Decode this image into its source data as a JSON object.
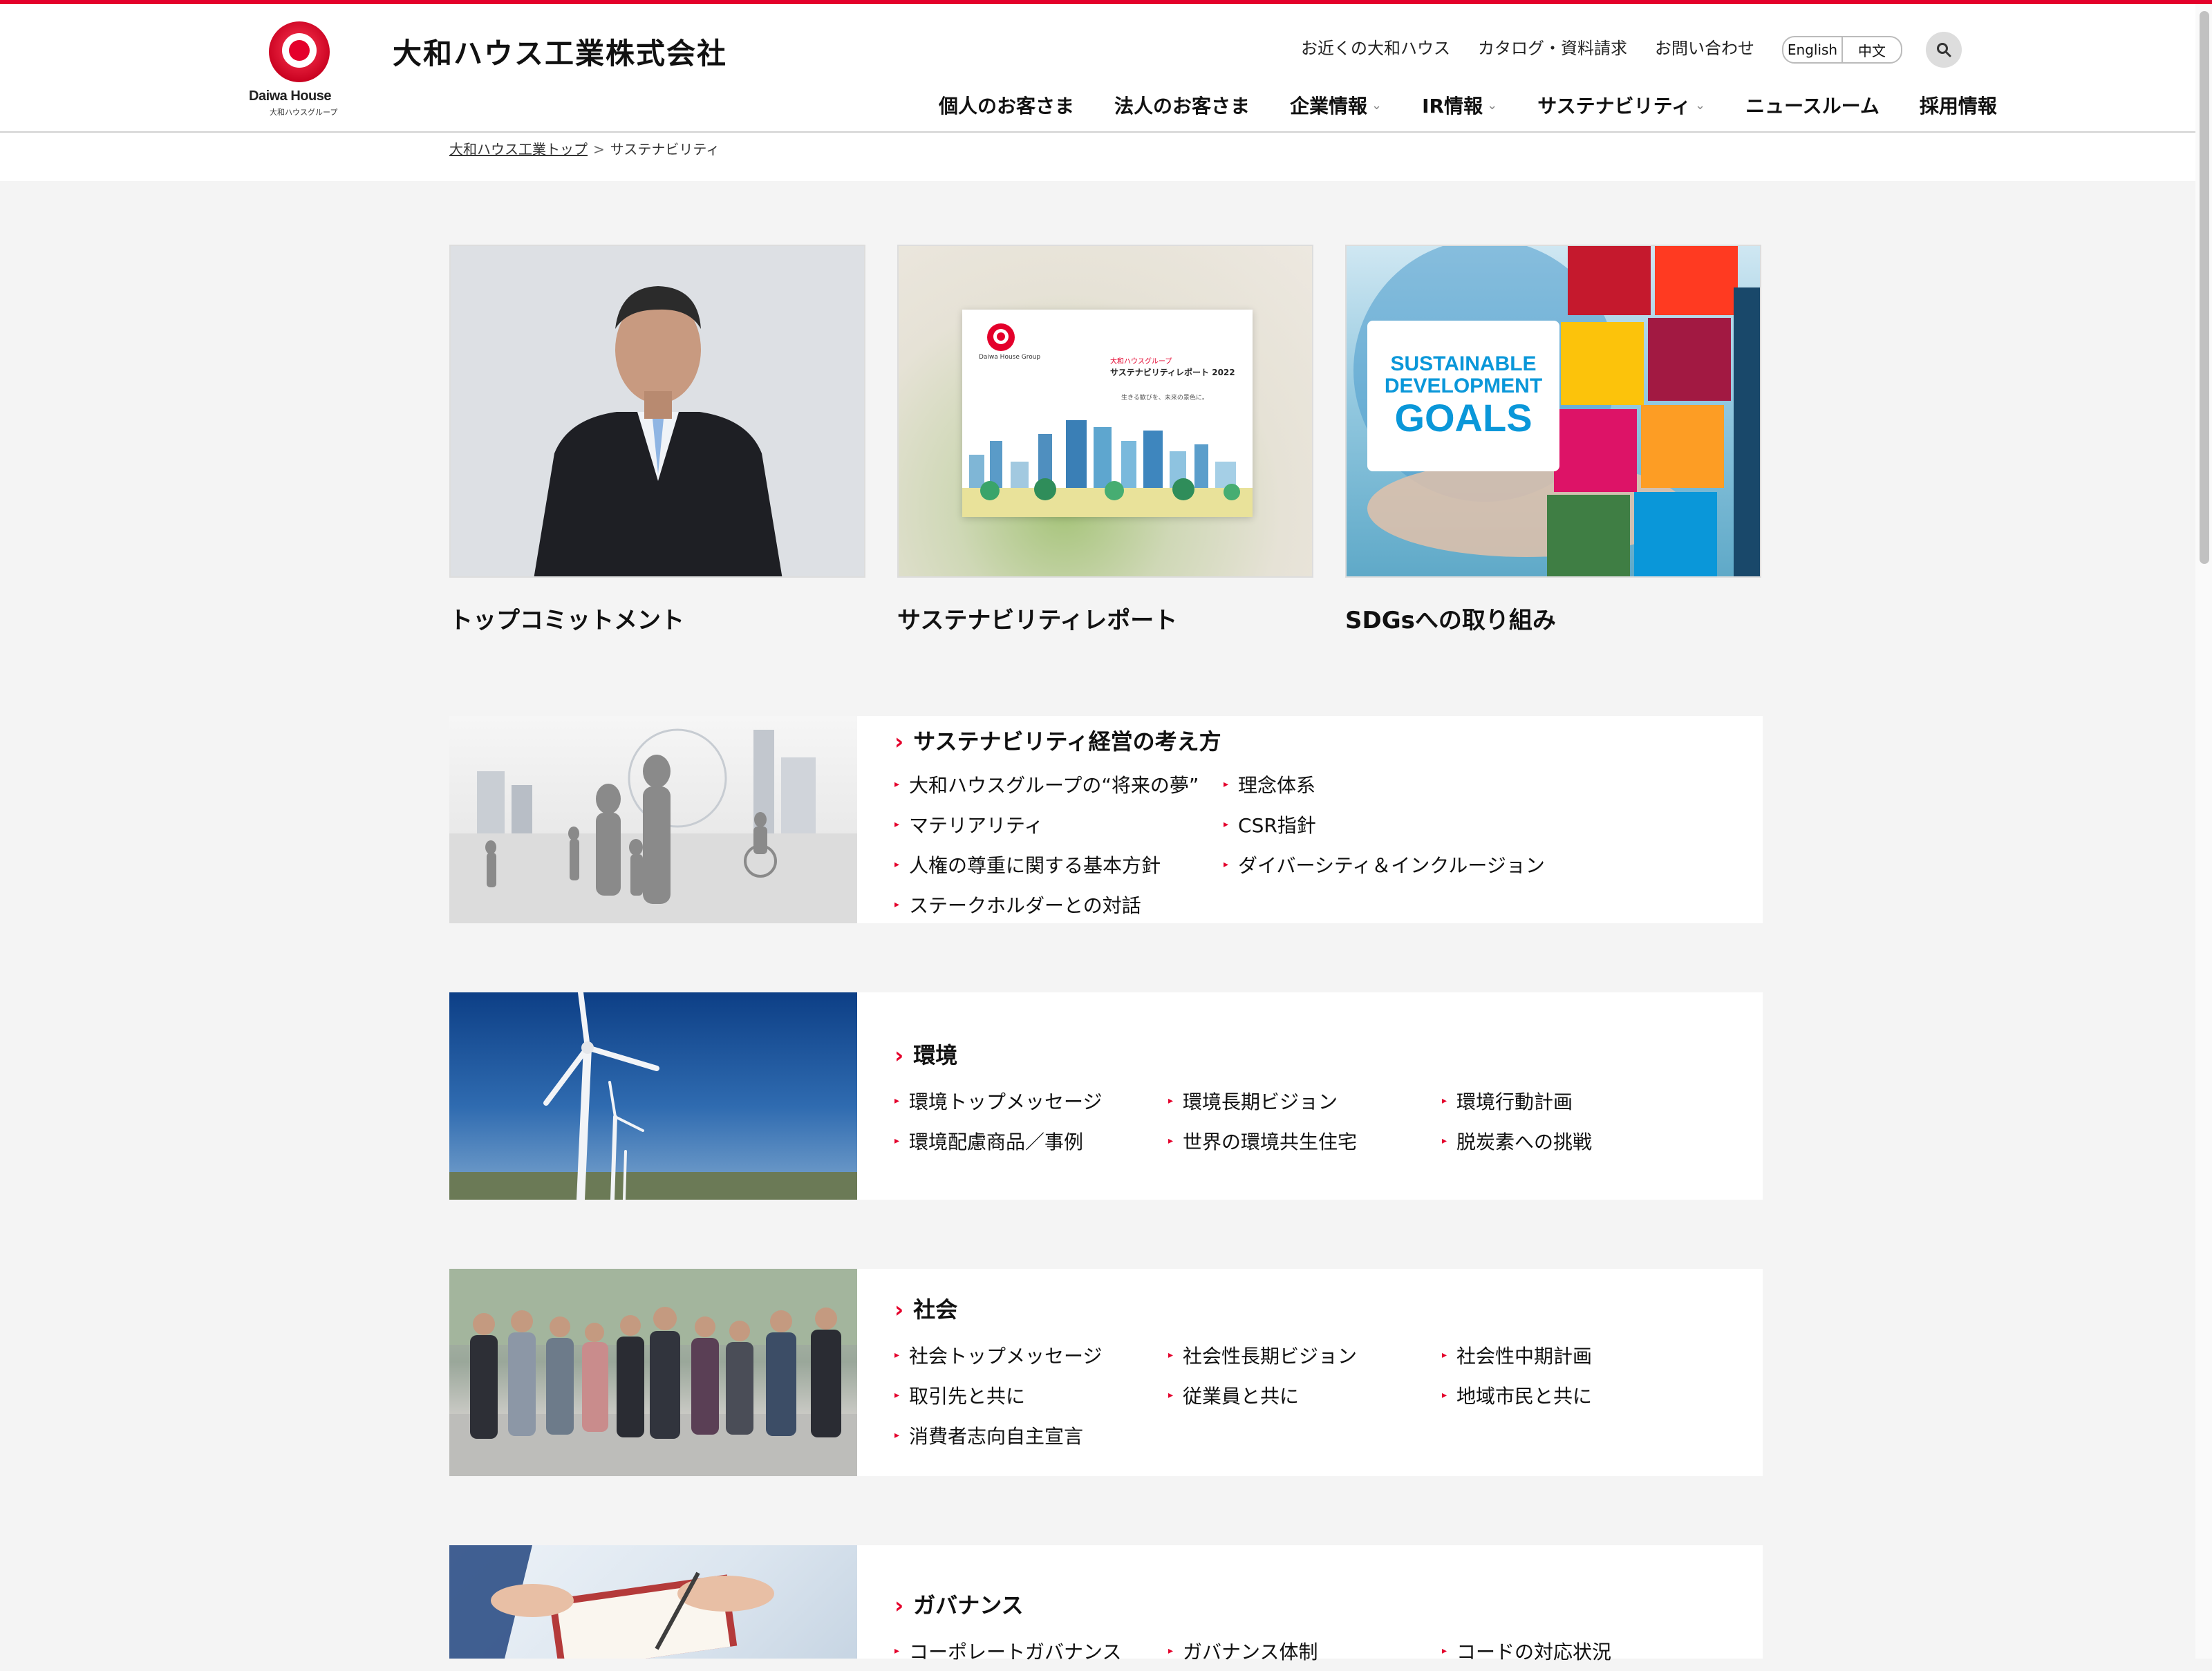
{
  "header": {
    "logo_brand": "Daiwa House",
    "logo_sub": "大和ハウスグループ",
    "company_name": "大和ハウス工業株式会社",
    "util_links": [
      "お近くの大和ハウス",
      "カタログ・資料請求",
      "お問い合わせ"
    ],
    "lang": [
      "English",
      "中文"
    ],
    "nav": [
      {
        "label": "個人のお客さま",
        "chevron": false
      },
      {
        "label": "法人のお客さま",
        "chevron": false
      },
      {
        "label": "企業情報",
        "chevron": true
      },
      {
        "label": "IR情報",
        "chevron": true
      },
      {
        "label": "サステナビリティ",
        "chevron": true
      },
      {
        "label": "ニュースルーム",
        "chevron": false
      },
      {
        "label": "採用情報",
        "chevron": false
      }
    ]
  },
  "breadcrumb": {
    "home": "大和ハウス工業トップ",
    "sep": ">",
    "current": "サステナビリティ"
  },
  "cards": [
    {
      "title": "トップコミットメント"
    },
    {
      "title": "サステナビリティレポート",
      "report_group": "大和ハウスグループ",
      "report_title": "サステナビリティレポート 2022",
      "report_tagline": "生きる歓びを、未来の景色に。",
      "report_logo": "Daiwa House Group"
    },
    {
      "title": "SDGsへの取り組み",
      "sdg_line1": "SUSTAINABLE",
      "sdg_line2": "DEVELOPMENT",
      "sdg_line3": "GOALS"
    }
  ],
  "sections": {
    "management": {
      "heading": "サステナビリティ経営の考え方",
      "links": [
        [
          "大和ハウスグループの“将来の夢”",
          "理念体系"
        ],
        [
          "マテリアリティ",
          "CSR指針"
        ],
        [
          "人権の尊重に関する基本方針",
          "ダイバーシティ＆インクルージョン"
        ],
        [
          "ステークホルダーとの対話"
        ]
      ]
    },
    "environment": {
      "heading": "環境",
      "links": [
        [
          "環境トップメッセージ",
          "環境長期ビジョン",
          "環境行動計画"
        ],
        [
          "環境配慮商品／事例",
          "世界の環境共生住宅",
          "脱炭素への挑戦"
        ]
      ]
    },
    "society": {
      "heading": "社会",
      "links": [
        [
          "社会トップメッセージ",
          "社会性長期ビジョン",
          "社会性中期計画"
        ],
        [
          "取引先と共に",
          "従業員と共に",
          "地域市民と共に"
        ],
        [
          "消費者志向自主宣言"
        ]
      ]
    },
    "governance": {
      "heading": "ガバナンス",
      "links": [
        [
          "コーポレートガバナンス",
          "ガバナンス体制",
          "コードの対応状況"
        ]
      ]
    }
  },
  "colors": {
    "accent": "#e4002b",
    "background": "#f4f4f4"
  }
}
